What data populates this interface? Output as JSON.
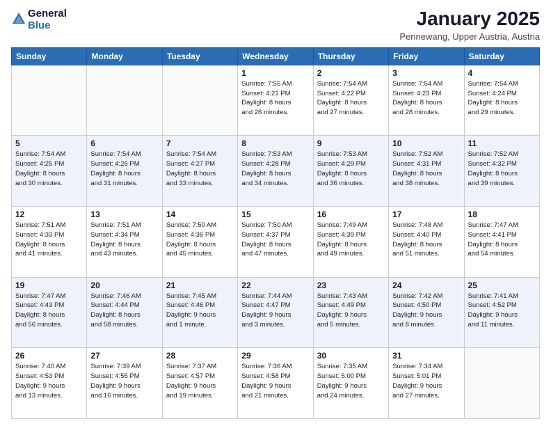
{
  "logo": {
    "general": "General",
    "blue": "Blue"
  },
  "header": {
    "month_year": "January 2025",
    "location": "Pennewang, Upper Austria, Austria"
  },
  "days_of_week": [
    "Sunday",
    "Monday",
    "Tuesday",
    "Wednesday",
    "Thursday",
    "Friday",
    "Saturday"
  ],
  "weeks": [
    [
      {
        "day": "",
        "info": ""
      },
      {
        "day": "",
        "info": ""
      },
      {
        "day": "",
        "info": ""
      },
      {
        "day": "1",
        "info": "Sunrise: 7:55 AM\nSunset: 4:21 PM\nDaylight: 8 hours\nand 26 minutes."
      },
      {
        "day": "2",
        "info": "Sunrise: 7:54 AM\nSunset: 4:22 PM\nDaylight: 8 hours\nand 27 minutes."
      },
      {
        "day": "3",
        "info": "Sunrise: 7:54 AM\nSunset: 4:23 PM\nDaylight: 8 hours\nand 28 minutes."
      },
      {
        "day": "4",
        "info": "Sunrise: 7:54 AM\nSunset: 4:24 PM\nDaylight: 8 hours\nand 29 minutes."
      }
    ],
    [
      {
        "day": "5",
        "info": "Sunrise: 7:54 AM\nSunset: 4:25 PM\nDaylight: 8 hours\nand 30 minutes."
      },
      {
        "day": "6",
        "info": "Sunrise: 7:54 AM\nSunset: 4:26 PM\nDaylight: 8 hours\nand 31 minutes."
      },
      {
        "day": "7",
        "info": "Sunrise: 7:54 AM\nSunset: 4:27 PM\nDaylight: 8 hours\nand 33 minutes."
      },
      {
        "day": "8",
        "info": "Sunrise: 7:53 AM\nSunset: 4:28 PM\nDaylight: 8 hours\nand 34 minutes."
      },
      {
        "day": "9",
        "info": "Sunrise: 7:53 AM\nSunset: 4:29 PM\nDaylight: 8 hours\nand 36 minutes."
      },
      {
        "day": "10",
        "info": "Sunrise: 7:52 AM\nSunset: 4:31 PM\nDaylight: 8 hours\nand 38 minutes."
      },
      {
        "day": "11",
        "info": "Sunrise: 7:52 AM\nSunset: 4:32 PM\nDaylight: 8 hours\nand 39 minutes."
      }
    ],
    [
      {
        "day": "12",
        "info": "Sunrise: 7:51 AM\nSunset: 4:33 PM\nDaylight: 8 hours\nand 41 minutes."
      },
      {
        "day": "13",
        "info": "Sunrise: 7:51 AM\nSunset: 4:34 PM\nDaylight: 8 hours\nand 43 minutes."
      },
      {
        "day": "14",
        "info": "Sunrise: 7:50 AM\nSunset: 4:36 PM\nDaylight: 8 hours\nand 45 minutes."
      },
      {
        "day": "15",
        "info": "Sunrise: 7:50 AM\nSunset: 4:37 PM\nDaylight: 8 hours\nand 47 minutes."
      },
      {
        "day": "16",
        "info": "Sunrise: 7:49 AM\nSunset: 4:39 PM\nDaylight: 8 hours\nand 49 minutes."
      },
      {
        "day": "17",
        "info": "Sunrise: 7:48 AM\nSunset: 4:40 PM\nDaylight: 8 hours\nand 51 minutes."
      },
      {
        "day": "18",
        "info": "Sunrise: 7:47 AM\nSunset: 4:41 PM\nDaylight: 8 hours\nand 54 minutes."
      }
    ],
    [
      {
        "day": "19",
        "info": "Sunrise: 7:47 AM\nSunset: 4:43 PM\nDaylight: 8 hours\nand 56 minutes."
      },
      {
        "day": "20",
        "info": "Sunrise: 7:46 AM\nSunset: 4:44 PM\nDaylight: 8 hours\nand 58 minutes."
      },
      {
        "day": "21",
        "info": "Sunrise: 7:45 AM\nSunset: 4:46 PM\nDaylight: 9 hours\nand 1 minute."
      },
      {
        "day": "22",
        "info": "Sunrise: 7:44 AM\nSunset: 4:47 PM\nDaylight: 9 hours\nand 3 minutes."
      },
      {
        "day": "23",
        "info": "Sunrise: 7:43 AM\nSunset: 4:49 PM\nDaylight: 9 hours\nand 5 minutes."
      },
      {
        "day": "24",
        "info": "Sunrise: 7:42 AM\nSunset: 4:50 PM\nDaylight: 9 hours\nand 8 minutes."
      },
      {
        "day": "25",
        "info": "Sunrise: 7:41 AM\nSunset: 4:52 PM\nDaylight: 9 hours\nand 11 minutes."
      }
    ],
    [
      {
        "day": "26",
        "info": "Sunrise: 7:40 AM\nSunset: 4:53 PM\nDaylight: 9 hours\nand 13 minutes."
      },
      {
        "day": "27",
        "info": "Sunrise: 7:39 AM\nSunset: 4:55 PM\nDaylight: 9 hours\nand 16 minutes."
      },
      {
        "day": "28",
        "info": "Sunrise: 7:37 AM\nSunset: 4:57 PM\nDaylight: 9 hours\nand 19 minutes."
      },
      {
        "day": "29",
        "info": "Sunrise: 7:36 AM\nSunset: 4:58 PM\nDaylight: 9 hours\nand 21 minutes."
      },
      {
        "day": "30",
        "info": "Sunrise: 7:35 AM\nSunset: 5:00 PM\nDaylight: 9 hours\nand 24 minutes."
      },
      {
        "day": "31",
        "info": "Sunrise: 7:34 AM\nSunset: 5:01 PM\nDaylight: 9 hours\nand 27 minutes."
      },
      {
        "day": "",
        "info": ""
      }
    ]
  ]
}
